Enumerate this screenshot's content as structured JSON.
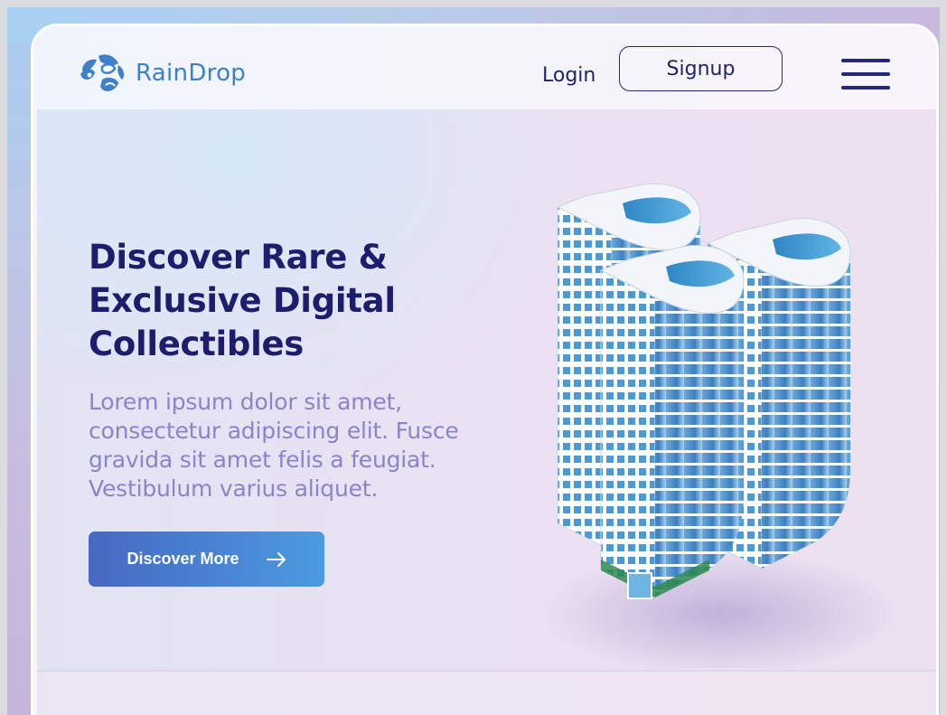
{
  "brand": {
    "name": "RainDrop",
    "logo_icon": "raindrop-logo-icon"
  },
  "header": {
    "login_label": "Login",
    "signup_label": "Signup",
    "menu_icon": "hamburger-menu-icon"
  },
  "hero": {
    "title_line1": "Discover Rare &",
    "title_line2": "Exclusive Digital",
    "title_line3": "Collectibles",
    "desc_line1": "Lorem ipsum dolor sit amet,",
    "desc_line2": "consectetur adipiscing elit. Fusce",
    "desc_line3": "gravida sit amet felis a feugiat.",
    "desc_line4": "Vestibulum varius aliquet.",
    "cta_label": "Discover More",
    "cta_icon": "arrow-right-icon",
    "illustration": "skyscraper-towers-illustration"
  },
  "colors": {
    "primary_text": "#1c1d6d",
    "brand_blue": "#3e80c9",
    "body_text": "#8a84c8",
    "cta_start": "#4768c2",
    "cta_end": "#4b9be0"
  }
}
